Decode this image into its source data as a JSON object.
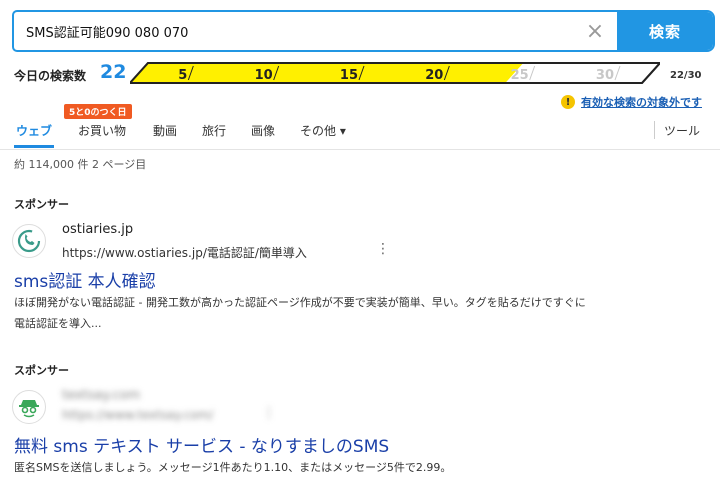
{
  "search": {
    "query": "SMS認証可能090 080 070",
    "clear_icon": "×",
    "button_label": "検索"
  },
  "counter": {
    "label": "今日の検索数",
    "value": "22",
    "marks": [
      "5",
      "10",
      "15",
      "20",
      "25",
      "30"
    ],
    "total": "22/30",
    "progress": 0.733,
    "fill_color": "#fff000"
  },
  "notice": {
    "icon": "!",
    "text": "有効な検索の対象外です"
  },
  "tabs": [
    {
      "label": "ウェブ",
      "active": true
    },
    {
      "label": "お買い物"
    },
    {
      "label": "動画"
    },
    {
      "label": "旅行"
    },
    {
      "label": "画像"
    },
    {
      "label": "その他 ▾"
    },
    {
      "label": "ツール"
    }
  ],
  "promo_badge": "5と0のつく日",
  "result_stats": "約 114,000 件  2 ページ目",
  "ads": [
    {
      "sponsor_label": "スポンサー",
      "site_name": "ostiaries.jp",
      "url": "https://www.ostiaries.jp/電話認証/簡単導入",
      "more_icon": "⋮",
      "title": "sms認証 本人確認",
      "description": "ほぼ開発がない電話認証 - 開発工数が高かった認証ページ作成が不要で実装が簡単、早い。タグを貼るだけですぐに電話認証を導入..."
    },
    {
      "sponsor_label": "スポンサー",
      "site_name": "textsay.com",
      "url": "https://www.textsay.com/",
      "more_icon": "⋮",
      "title": "無料 sms テキスト サービス - なりすましのSMS",
      "description": "匿名SMSを送信しましょう。メッセージ1件あたり1.10、またはメッセージ5件で2.99。"
    }
  ]
}
